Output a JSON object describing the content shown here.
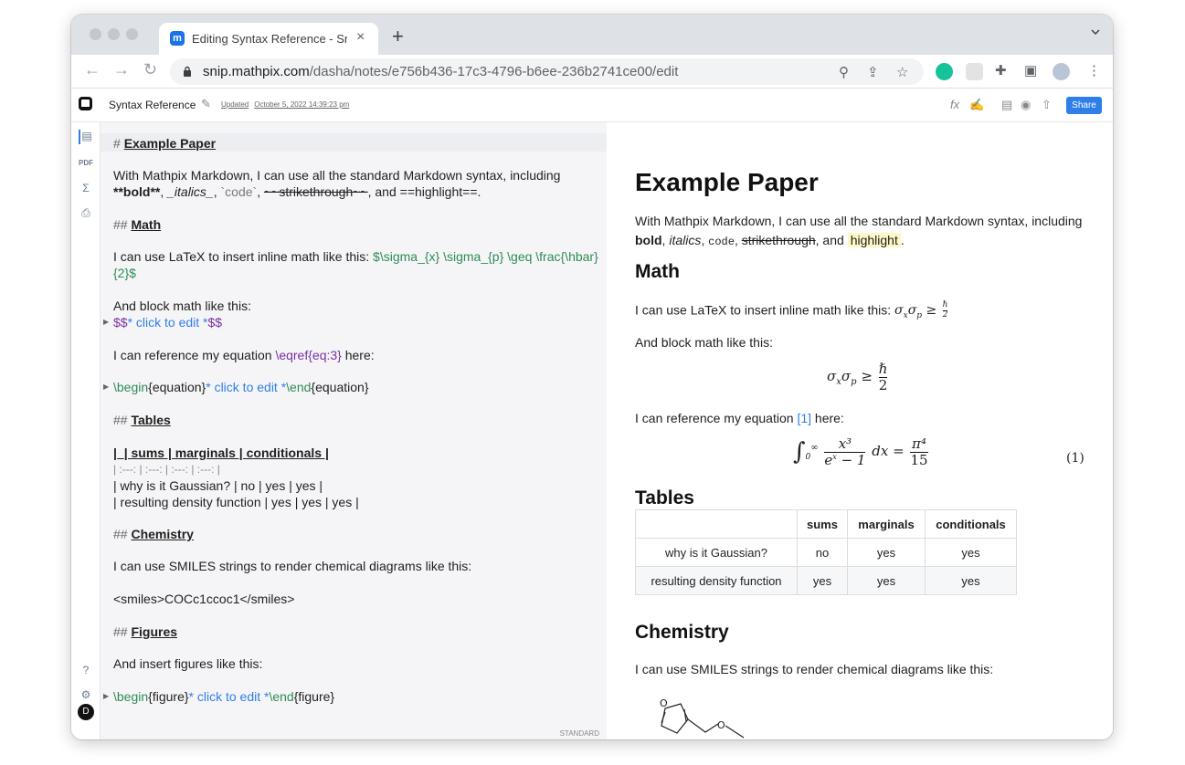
{
  "browser": {
    "tab_title": "Editing Syntax Reference - Snip",
    "tab_close": "×",
    "new_tab": "+",
    "url_host": "snip.mathpix.com",
    "url_path": "/dasha/notes/e756b436-17c3-4796-b6ee-236b2741ce00/edit",
    "favicon": "m"
  },
  "toolbar": {
    "title": "Syntax Reference",
    "updated_label": "Updated",
    "updated_date": "October 5, 2022 14:39:23 pm",
    "share_label": "Share"
  },
  "rail": {
    "avatar_initial": "D"
  },
  "editor": {
    "mode_label": "STANDARD",
    "h1_marker": "#",
    "h1_text": "Example Paper",
    "p1_line1": "With Mathpix Markdown, I can use all the standard Markdown syntax, including",
    "p1_bold": "**bold**",
    "p1_sep1": ",",
    "p1_italics": "_italics_",
    "p1_sep2": ",",
    "p1_code": "`code`",
    "p1_sep3": ",",
    "p1_strike": "~~strikethrough~~",
    "p1_tail": ", and ==highlight==.",
    "h_math_marker": "##",
    "h_math": "Math",
    "math_line1_text": "I can use LaTeX to insert inline math like this:",
    "math_line1_code": "$\\sigma_{x} \\sigma_{p} \\geq \\frac{\\hbar}",
    "math_line2_code": "{2}$",
    "block_text": "And block math like this:",
    "block_dollar_open": "$$",
    "block_click": "* click to edit *",
    "block_dollar_close": "$$",
    "ref_text_a": "I can reference my equation",
    "ref_code": "\\eqref{eq:3}",
    "ref_text_b": "here:",
    "eq_begin": "\\begin",
    "eq_env": "{equation}",
    "eq_click": "* click to edit *",
    "eq_end": "\\end",
    "eq_env2": "{equation}",
    "h_tables_marker": "##",
    "h_tables": "Tables",
    "tbl_row1": "|_| sums | marginals | conditionals |",
    "tbl_row2": "| :---: | :---: | :---: | :---: |",
    "tbl_row3": "| why is it Gaussian? | no | yes | yes |",
    "tbl_row4": "| resulting density function | yes | yes | yes |",
    "h_chem_marker": "##",
    "h_chem": "Chemistry",
    "chem_text": "I can use SMILES strings to render chemical diagrams like this:",
    "smiles_open": "<smiles>",
    "smiles_code": "COCc1ccoc1",
    "smiles_close": "</smiles>",
    "h_fig_marker": "##",
    "h_fig": "Figures",
    "fig_text": "And insert figures like this:",
    "fig_begin": "\\begin",
    "fig_env": "{figure}",
    "fig_click": "* click to edit *",
    "fig_end": "\\end",
    "fig_env2": "{figure}"
  },
  "preview": {
    "h1": "Example Paper",
    "p1_line1": "With Mathpix Markdown, I can use all the standard Markdown syntax, including",
    "p1_bold": "bold",
    "p1_italics": "italics",
    "p1_code": "code",
    "p1_strike": "strikethrough",
    "p1_and": ", and",
    "p1_highlight": "highlight",
    "h_math": "Math",
    "math_text": "I can use LaTeX to insert inline math like this:",
    "block_text": "And block math like this:",
    "ref_text_a": "I can reference my equation",
    "ref_link": "[1]",
    "ref_text_b": "here:",
    "eq_number": "(1)",
    "h_tables": "Tables",
    "table_headers": [
      "",
      "sums",
      "marginals",
      "conditionals"
    ],
    "table_rows": [
      [
        "why is it Gaussian?",
        "no",
        "yes",
        "yes"
      ],
      [
        "resulting density function",
        "yes",
        "yes",
        "yes"
      ]
    ],
    "h_chem": "Chemistry",
    "chem_text": "I can use SMILES strings to render chemical diagrams like this:"
  }
}
